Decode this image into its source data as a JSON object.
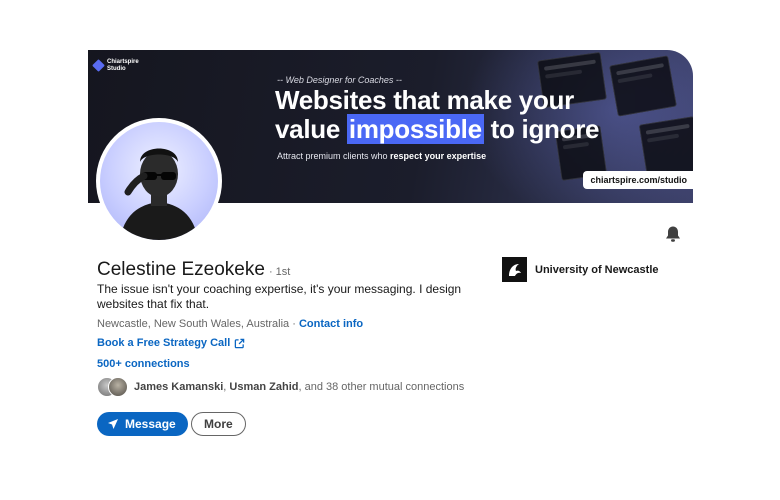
{
  "banner": {
    "brand": "Chiartspire Studio",
    "tagline": "-- Web Designer for Coaches --",
    "headline_line1": "Websites that make your",
    "headline_pre": "value ",
    "headline_highlight": "impossible",
    "headline_post": " to ignore",
    "subline_pre": "Attract premium clients who ",
    "subline_bold": "respect your expertise",
    "url": "chiartspire.com/studio",
    "accent_color": "#4a68f5"
  },
  "profile": {
    "name": "Celestine Ezeokeke",
    "degree": "· 1st",
    "headline": "The issue isn't your coaching expertise, it's your messaging. I design websites that fix that.",
    "location": "Newcastle, New South Wales, Australia",
    "location_sep": " · ",
    "contact_info": "Contact info",
    "cta_link": "Book a Free Strategy Call",
    "connections": "500+ connections",
    "mutual_name1": "James Kamanski",
    "mutual_sep": ", ",
    "mutual_name2": "Usman Zahid",
    "mutual_rest": ", and 38 other mutual connections"
  },
  "education": {
    "name": "University of Newcastle"
  },
  "actions": {
    "message_label": "Message",
    "more_label": "More"
  },
  "icons": {
    "notification": "bell-icon",
    "external_link": "external-link-icon",
    "send": "paper-plane-icon"
  },
  "colors": {
    "link": "#0a66c2",
    "primary_button": "#0a66c2"
  }
}
